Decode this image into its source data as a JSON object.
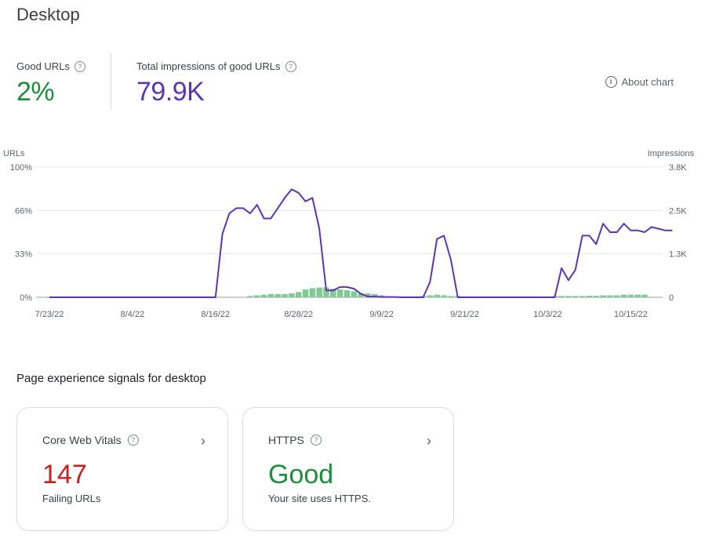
{
  "page": {
    "title": "Desktop"
  },
  "metrics": {
    "good_urls": {
      "label": "Good URLs",
      "value": "2%",
      "help_icon": "?"
    },
    "impressions": {
      "label": "Total impressions of good URLs",
      "value": "79.9K",
      "help_icon": "?"
    }
  },
  "about_chart": {
    "label": "About chart",
    "icon": "i"
  },
  "chart_data": {
    "type": "bar+line",
    "ylabel_left": "URLs",
    "ylabel_right": "Impressions",
    "yticks_left": [
      "100%",
      "66%",
      "33%",
      "0%"
    ],
    "yticks_right": [
      "3.8K",
      "2.5K",
      "1.3K",
      "0"
    ],
    "ylim_left": [
      0,
      100
    ],
    "ylim_right": [
      0,
      3800
    ],
    "x_tick_labels": [
      "7/23/22",
      "8/4/22",
      "8/16/22",
      "8/28/22",
      "9/9/22",
      "9/21/22",
      "10/3/22",
      "10/15/22"
    ],
    "x_tick_index": [
      0,
      12,
      24,
      36,
      48,
      60,
      72,
      84
    ],
    "series": [
      {
        "name": "Good URLs %",
        "axis": "left",
        "values": [
          0.5,
          0.5,
          0.5,
          0.5,
          0.5,
          0.5,
          0.5,
          0.5,
          0.5,
          0.5,
          0.5,
          0.5,
          0.5,
          0.5,
          0.5,
          0.5,
          0.5,
          0.5,
          0.5,
          0.5,
          0.5,
          0.5,
          0.5,
          0.5,
          0,
          0,
          0,
          0,
          0,
          1,
          1.5,
          2,
          2.5,
          2.5,
          2.5,
          3,
          4,
          6,
          7,
          7.5,
          7.5,
          6.5,
          6,
          5.5,
          4.5,
          3,
          3,
          2.5,
          1.5,
          0.5,
          0.5,
          0.5,
          0.5,
          0.5,
          1,
          1.5,
          2,
          1.5,
          1,
          1,
          0.5,
          0.5,
          0.5,
          0.5,
          0.5,
          0,
          0,
          0,
          0,
          0,
          0,
          0,
          0.5,
          1,
          1,
          1,
          1,
          1,
          1.2,
          1.2,
          1.5,
          1.5,
          1.5,
          2,
          2,
          2,
          2
        ]
      },
      {
        "name": "Impressions",
        "axis": "right",
        "values": [
          0,
          0,
          0,
          0,
          0,
          0,
          0,
          0,
          0,
          0,
          0,
          0,
          0,
          0,
          0,
          0,
          0,
          0,
          0,
          0,
          0,
          0,
          0,
          0,
          0,
          1850,
          2450,
          2600,
          2600,
          2450,
          2700,
          2300,
          2300,
          2600,
          2900,
          3150,
          3050,
          2800,
          2900,
          2000,
          200,
          200,
          300,
          300,
          250,
          100,
          20,
          20,
          10,
          10,
          10,
          0,
          0,
          0,
          0,
          450,
          1700,
          1800,
          1100,
          0,
          0,
          0,
          0,
          0,
          0,
          0,
          0,
          0,
          0,
          0,
          0,
          0,
          0,
          0,
          850,
          500,
          800,
          1800,
          1800,
          1550,
          2150,
          1900,
          1900,
          2150,
          1950,
          1950,
          1900,
          2050,
          2000,
          1950,
          1950
        ]
      }
    ],
    "colors": {
      "bars": "#81c995",
      "line": "#5e35b1"
    },
    "grid": true
  },
  "section": {
    "title": "Page experience signals for desktop"
  },
  "cards": [
    {
      "title": "Core Web Vitals",
      "value": "147",
      "subtitle": "Failing URLs",
      "help_icon": "?",
      "chevron": "›"
    },
    {
      "title": "HTTPS",
      "value": "Good",
      "subtitle": "Your site uses HTTPS.",
      "help_icon": "?",
      "chevron": "›"
    }
  ]
}
